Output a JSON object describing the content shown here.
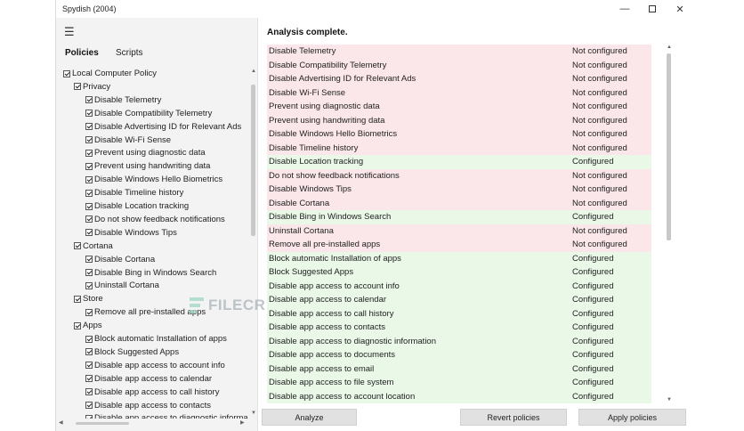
{
  "window": {
    "title": "Spydish (2004)"
  },
  "left": {
    "tabs": {
      "policies": "Policies",
      "scripts": "Scripts"
    },
    "tree": [
      {
        "label": "Local Computer Policy",
        "level": 0
      },
      {
        "label": "Privacy",
        "level": 1
      },
      {
        "label": "Disable Telemetry",
        "level": 2
      },
      {
        "label": "Disable Compatibility Telemetry",
        "level": 2
      },
      {
        "label": "Disable Advertising ID for Relevant Ads",
        "level": 2
      },
      {
        "label": "Disable Wi-Fi Sense",
        "level": 2
      },
      {
        "label": "Prevent using diagnostic data",
        "level": 2
      },
      {
        "label": "Prevent using handwriting data",
        "level": 2
      },
      {
        "label": "Disable Windows Hello Biometrics",
        "level": 2
      },
      {
        "label": "Disable Timeline history",
        "level": 2
      },
      {
        "label": "Disable Location tracking",
        "level": 2
      },
      {
        "label": "Do not show feedback notifications",
        "level": 2
      },
      {
        "label": "Disable Windows Tips",
        "level": 2
      },
      {
        "label": "Cortana",
        "level": 1
      },
      {
        "label": "Disable Cortana",
        "level": 2
      },
      {
        "label": "Disable Bing in Windows Search",
        "level": 2
      },
      {
        "label": "Uninstall Cortana",
        "level": 2
      },
      {
        "label": "Store",
        "level": 1
      },
      {
        "label": "Remove all pre-installed apps",
        "level": 2
      },
      {
        "label": "Apps",
        "level": 1
      },
      {
        "label": "Block automatic Installation of apps",
        "level": 2
      },
      {
        "label": "Block Suggested Apps",
        "level": 2
      },
      {
        "label": "Disable app access to account info",
        "level": 2
      },
      {
        "label": "Disable app access to calendar",
        "level": 2
      },
      {
        "label": "Disable app access to call history",
        "level": 2
      },
      {
        "label": "Disable app access to contacts",
        "level": 2
      },
      {
        "label": "Disable app access to diagnostic informa",
        "level": 2
      }
    ]
  },
  "right": {
    "title": "Analysis complete.",
    "rows": [
      {
        "name": "Disable Telemetry",
        "status": "Not configured",
        "state": "nc"
      },
      {
        "name": "Disable Compatibility Telemetry",
        "status": "Not configured",
        "state": "nc"
      },
      {
        "name": "Disable Advertising ID for Relevant Ads",
        "status": "Not configured",
        "state": "nc"
      },
      {
        "name": "Disable Wi-Fi Sense",
        "status": "Not configured",
        "state": "nc"
      },
      {
        "name": "Prevent using diagnostic data",
        "status": "Not configured",
        "state": "nc"
      },
      {
        "name": "Prevent using handwriting data",
        "status": "Not configured",
        "state": "nc"
      },
      {
        "name": "Disable Windows Hello Biometrics",
        "status": "Not configured",
        "state": "nc"
      },
      {
        "name": "Disable Timeline history",
        "status": "Not configured",
        "state": "nc"
      },
      {
        "name": "Disable Location tracking",
        "status": "Configured",
        "state": "c"
      },
      {
        "name": "Do not show feedback notifications",
        "status": "Not configured",
        "state": "nc"
      },
      {
        "name": "Disable Windows Tips",
        "status": "Not configured",
        "state": "nc"
      },
      {
        "name": "Disable Cortana",
        "status": "Not configured",
        "state": "nc"
      },
      {
        "name": "Disable Bing in Windows Search",
        "status": "Configured",
        "state": "c"
      },
      {
        "name": "Uninstall Cortana",
        "status": "Not configured",
        "state": "nc"
      },
      {
        "name": "Remove all pre-installed apps",
        "status": "Not configured",
        "state": "nc"
      },
      {
        "name": "Block automatic Installation of apps",
        "status": "Configured",
        "state": "c"
      },
      {
        "name": "Block Suggested Apps",
        "status": "Configured",
        "state": "c"
      },
      {
        "name": "Disable app access to account info",
        "status": "Configured",
        "state": "c"
      },
      {
        "name": "Disable app access to calendar",
        "status": "Configured",
        "state": "c"
      },
      {
        "name": "Disable app access to call history",
        "status": "Configured",
        "state": "c"
      },
      {
        "name": "Disable app access to contacts",
        "status": "Configured",
        "state": "c"
      },
      {
        "name": "Disable app access to diagnostic information",
        "status": "Configured",
        "state": "c"
      },
      {
        "name": "Disable app access to documents",
        "status": "Configured",
        "state": "c"
      },
      {
        "name": "Disable app access to email",
        "status": "Configured",
        "state": "c"
      },
      {
        "name": "Disable app access to file system",
        "status": "Configured",
        "state": "c"
      },
      {
        "name": "Disable app access to account location",
        "status": "Configured",
        "state": "c"
      }
    ]
  },
  "buttons": {
    "analyze": "Analyze",
    "revert": "Revert policies",
    "apply": "Apply policies"
  },
  "watermark": {
    "text": "FILECR"
  },
  "icons": {
    "menu": "hamburger-icon",
    "minimize": "minimize-icon",
    "maximize": "maximize-icon",
    "close": "close-icon"
  }
}
